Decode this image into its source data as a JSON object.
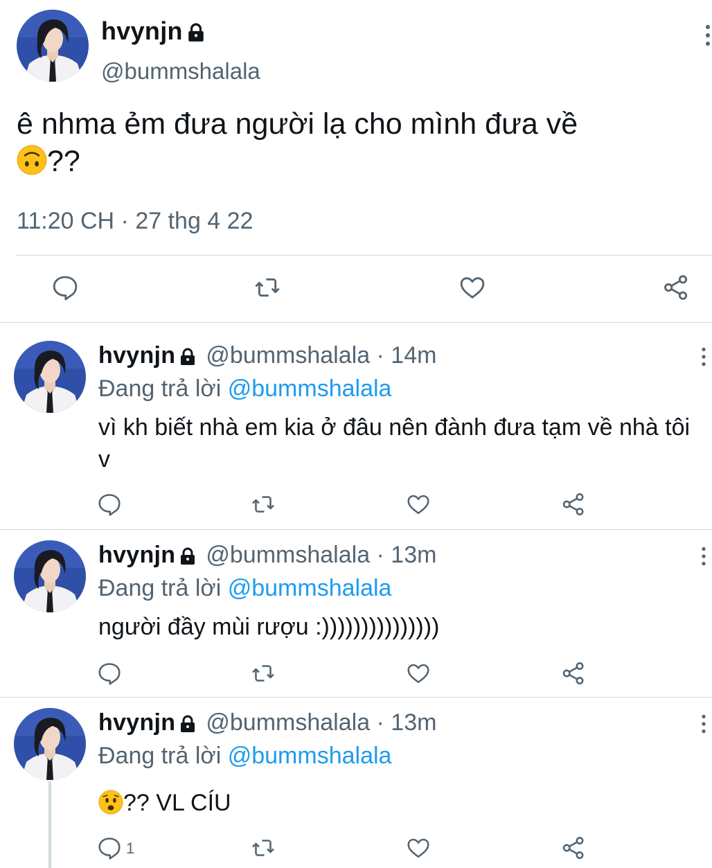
{
  "main_tweet": {
    "display_name": "hvynjn",
    "handle": "@bummshalala",
    "text": "ê nhma ẻm đưa người lạ cho mình đưa về",
    "text_line2": "??",
    "emoji": "upside-down-face",
    "timestamp": "11:20 CH · 27 thg 4 22",
    "icons": [
      "reply-icon",
      "retweet-icon",
      "like-icon",
      "share-icon"
    ]
  },
  "replies": [
    {
      "display_name": "hvynjn",
      "handle_time": "@bummshalala · 14m",
      "replying_prefix": "Đang trả lời",
      "replying_to": "@bummshalala",
      "text": "vì kh biết nhà em kia ở đâu nên đành đưa tạm về nhà tôi v",
      "reply_count": ""
    },
    {
      "display_name": "hvynjn",
      "handle_time": "@bummshalala · 13m",
      "replying_prefix": "Đang trả lời",
      "replying_to": "@bummshalala",
      "text": "người đầy mùi rượu :)))))))))))))))",
      "reply_count": ""
    },
    {
      "display_name": "hvynjn",
      "handle_time": "@bummshalala · 13m",
      "replying_prefix": "Đang trả lời",
      "replying_to": "@bummshalala",
      "emoji": "worried-face",
      "text": "?? VL CÍU",
      "reply_count": "1"
    }
  ],
  "colors": {
    "text": "#0f1419",
    "secondary": "#536471",
    "link": "#1d9bf0",
    "divider": "#cfd9de"
  }
}
